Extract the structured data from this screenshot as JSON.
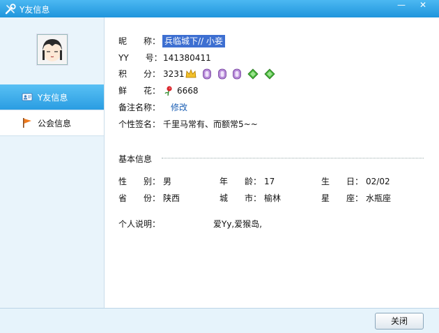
{
  "window": {
    "title": "Y友信息",
    "minimize_glyph": "—",
    "close_glyph": "✕"
  },
  "sidebar": {
    "items": [
      {
        "label": "Y友信息",
        "icon": "id-card-icon",
        "active": true
      },
      {
        "label": "公会信息",
        "icon": "flag-icon",
        "active": false
      }
    ]
  },
  "profile": {
    "nickname": {
      "label": "昵　　称：",
      "value": "兵临城下// 小妾"
    },
    "yy": {
      "label": "YY　　号：",
      "value": "141380411"
    },
    "points": {
      "label": "积　　分：",
      "value": "3231"
    },
    "flowers": {
      "label": "鲜　　花：",
      "value": "6668"
    },
    "remark": {
      "label": "备注名称：",
      "link": "修改"
    },
    "signature": {
      "label": "个性签名：",
      "value": "千里马常有、而额常5~~"
    }
  },
  "basic": {
    "section_title": "基本信息",
    "gender": {
      "label": "性　　别：",
      "value": "男"
    },
    "age": {
      "label": "年　　龄：",
      "value": "17"
    },
    "birthday": {
      "label": "生　　日：",
      "value": "02/02"
    },
    "province": {
      "label": "省　　份：",
      "value": "陕西"
    },
    "city": {
      "label": "城　　市：",
      "value": "榆林"
    },
    "zodiac": {
      "label": "星　　座：",
      "value": "水瓶座"
    },
    "description": {
      "label": "个人说明：",
      "value": "爱Yy,爱猴岛,"
    }
  },
  "footer": {
    "close_label": "关闭"
  },
  "colors": {
    "titlebar": "#2a9de2",
    "active_nav": "#3aa9ea",
    "highlight": "#3d6fd1",
    "link": "#1b5fb4"
  }
}
